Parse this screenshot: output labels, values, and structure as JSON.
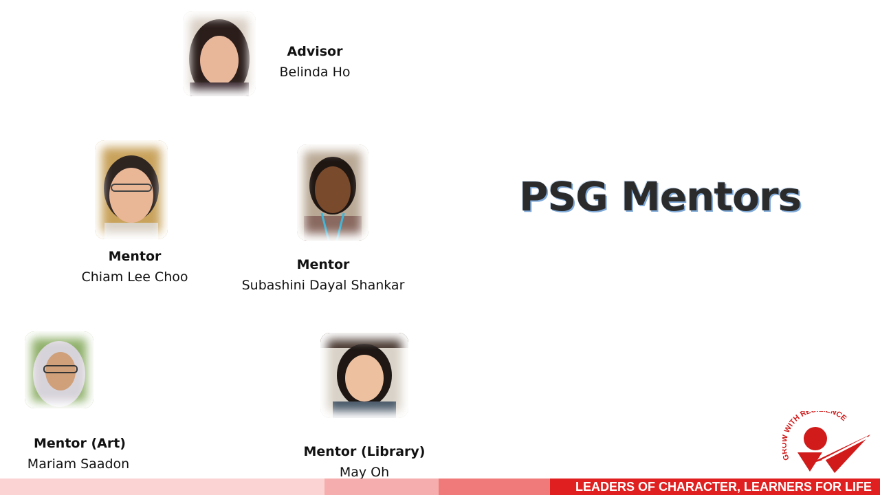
{
  "slide": {
    "title": "PSG Mentors",
    "tagline": "LEADERS OF CHARACTER, LEARNERS FOR LIFE",
    "logo_text": "GROW WITH RESILIENCE"
  },
  "people": [
    {
      "role": "Advisor",
      "name": "Belinda Ho"
    },
    {
      "role": "Mentor",
      "name": "Chiam Lee Choo"
    },
    {
      "role": "Mentor",
      "name": "Subashini Dayal Shankar"
    },
    {
      "role": "Mentor (Art)",
      "name": "Mariam Saadon"
    },
    {
      "role": "Mentor (Library)",
      "name": "May Oh"
    }
  ],
  "colors": {
    "brand_red": "#e02020",
    "footer_light": "#f9c9c9",
    "footer_mid": "#f4a3a3",
    "footer_dark": "#ee6b6b"
  }
}
